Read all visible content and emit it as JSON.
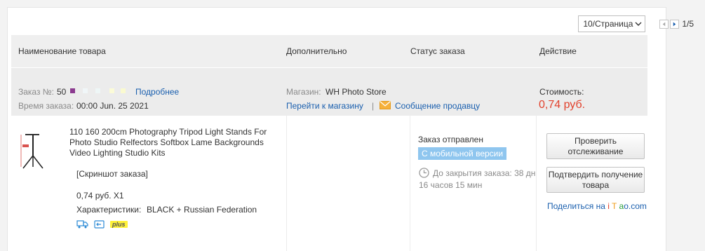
{
  "pager": {
    "page_size": "10/Страница",
    "page_indicator": "1/5"
  },
  "table_header": {
    "product": "Наименование товара",
    "additional": "Дополнительно",
    "status": "Статус заказа",
    "action": "Действие"
  },
  "order": {
    "number_label": "Заказ №:",
    "number_visible": "50",
    "details_link": "Подробнее",
    "time_label": "Время заказа:",
    "time_value": "00:00 Jun. 25 2021",
    "store_label": "Магазин:",
    "store_name": "WH Photo Store",
    "go_to_store": "Перейти к магазину",
    "separator": "|",
    "message_seller": "Сообщение продавцу",
    "cost_label": "Стоимость:",
    "cost_value": "0,74 руб."
  },
  "item": {
    "title": "110 160 200cm Photography Tripod Light Stands For Photo Studio Relfectors Softbox Lame Backgrounds Video Lighting Studio Kits",
    "screenshot_link": "[Скриншот заказа]",
    "price_qty": "0,74 руб. X1",
    "specs_label": "Характеристики:",
    "specs_value": "BLACK + Russian Federation",
    "plus_badge": "plus"
  },
  "status": {
    "title": "Заказ отправлен",
    "mobile_badge": "С мобильной версии",
    "countdown": "До закрытия заказа: 38 дн 16 часов 15 мин"
  },
  "actions": {
    "track_button": "Проверить отслеживание",
    "confirm_button": "Подтвердить получение товара",
    "share_prefix": "Поделиться на",
    "share_site_i": "i",
    "share_site_t": "T",
    "share_site_a": "a",
    "share_site_rest": "o.com"
  },
  "colors": {
    "price": "#e2402b",
    "link": "#1a5fae",
    "mobile_badge_bg": "#8fc6ef",
    "plus_badge_bg": "#fff23a"
  }
}
